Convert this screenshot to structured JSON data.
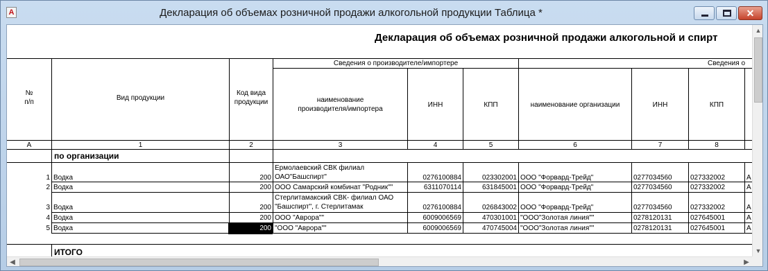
{
  "window": {
    "title": "Декларация об объемах розничной продажи алкогольной продукции Таблица  *",
    "icon": "pdf-app-icon",
    "controls": {
      "minimize": "minimize-icon",
      "maximize": "maximize-icon",
      "close": "close-icon"
    },
    "close_glyph": "✕"
  },
  "doc": {
    "title": "Декларация об объемах розничной продажи  алкогольной  и спирт",
    "header": {
      "group_producer": "Сведения о производителе/импортере",
      "group_second": "Сведения о",
      "col_num": "№\nп/п",
      "col_type": "Вид продукции",
      "col_code": "Код вида\nпродукции",
      "col_producer_name": "наименование\nпроизводителя/импортера",
      "col_inn": "ИНН",
      "col_kpp": "КПП",
      "col_org_name": "наименование организации",
      "col_inn2": "ИНН",
      "col_kpp2": "КПП"
    },
    "numbering": [
      "А",
      "1",
      "2",
      "3",
      "4",
      "5",
      "6",
      "7",
      "8"
    ],
    "section_label": "по организации",
    "total_label": "ИТОГО",
    "rows": [
      {
        "num": "1",
        "type": "Водка",
        "code": "200",
        "producer": "Ермолаевский СВК филиал\nОАО\"Башспирт\"",
        "inn": "0276100884",
        "kpp": "023302001",
        "org": "ООО \"Форвард-Трейд\"",
        "inn2": "0277034560",
        "kpp2": "027332002",
        "extra": "А"
      },
      {
        "num": "2",
        "type": "Водка",
        "code": "200",
        "producer": "ООО Самарский комбинат \"Родник\"\"",
        "inn": "6311070114",
        "kpp": "631845001",
        "org": "ООО \"Форвард-Трейд\"",
        "inn2": "0277034560",
        "kpp2": "027332002",
        "extra": "А"
      },
      {
        "num": "3",
        "type": "Водка",
        "code": "200",
        "producer": "Стерлитамакский СВК- филиал ОАО\n\"Башспирт\", г. Стерлитамак",
        "inn": "0276100884",
        "kpp": "026843002",
        "org": "ООО \"Форвард-Трейд\"",
        "inn2": "0277034560",
        "kpp2": "027332002",
        "extra": "А"
      },
      {
        "num": "4",
        "type": "Водка",
        "code": "200",
        "producer": "ООО \"Аврора\"\"",
        "inn": "6009006569",
        "kpp": "470301001",
        "org": "\"ООО\"Золотая линия\"\"",
        "inn2": "0278120131",
        "kpp2": "027645001",
        "extra": "А"
      },
      {
        "num": "5",
        "type": "Водка",
        "code": "200",
        "producer": "\"ООО \"Аврора\"\"",
        "inn": "6009006569",
        "kpp": "470745004",
        "org": "\"ООО\"Золотая линия\"\"",
        "inn2": "0278120131",
        "kpp2": "027645001",
        "extra": "А"
      }
    ]
  },
  "scrollbars": {
    "up": "scroll-up-icon",
    "down": "scroll-down-icon",
    "left": "scroll-left-icon",
    "right": "scroll-right-icon",
    "up_glyph": "▲",
    "down_glyph": "▼",
    "left_glyph": "◀",
    "right_glyph": "▶"
  }
}
